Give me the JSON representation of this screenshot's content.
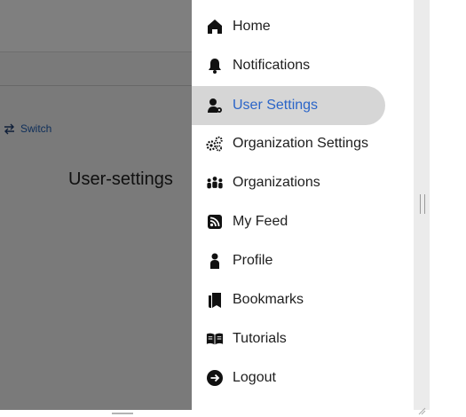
{
  "background": {
    "switch_label": "Switch",
    "heading": "User-settings"
  },
  "drawer": {
    "items": [
      {
        "label": "Home",
        "icon": "home-icon"
      },
      {
        "label": "Notifications",
        "icon": "bell-icon"
      },
      {
        "label": "User Settings",
        "icon": "user-settings-icon",
        "active": true
      },
      {
        "label": "Organization Settings",
        "icon": "gears-icon"
      },
      {
        "label": "Organizations",
        "icon": "people-icon"
      },
      {
        "label": "My Feed",
        "icon": "rss-icon"
      },
      {
        "label": "Profile",
        "icon": "person-icon"
      },
      {
        "label": "Bookmarks",
        "icon": "bookmarks-icon"
      },
      {
        "label": "Tutorials",
        "icon": "book-open-icon"
      },
      {
        "label": "Logout",
        "icon": "logout-icon"
      }
    ]
  },
  "colors": {
    "accent": "#2b65c8",
    "active_bg": "#d6d6d6",
    "backdrop": "rgba(0,0,0,0.5)"
  }
}
